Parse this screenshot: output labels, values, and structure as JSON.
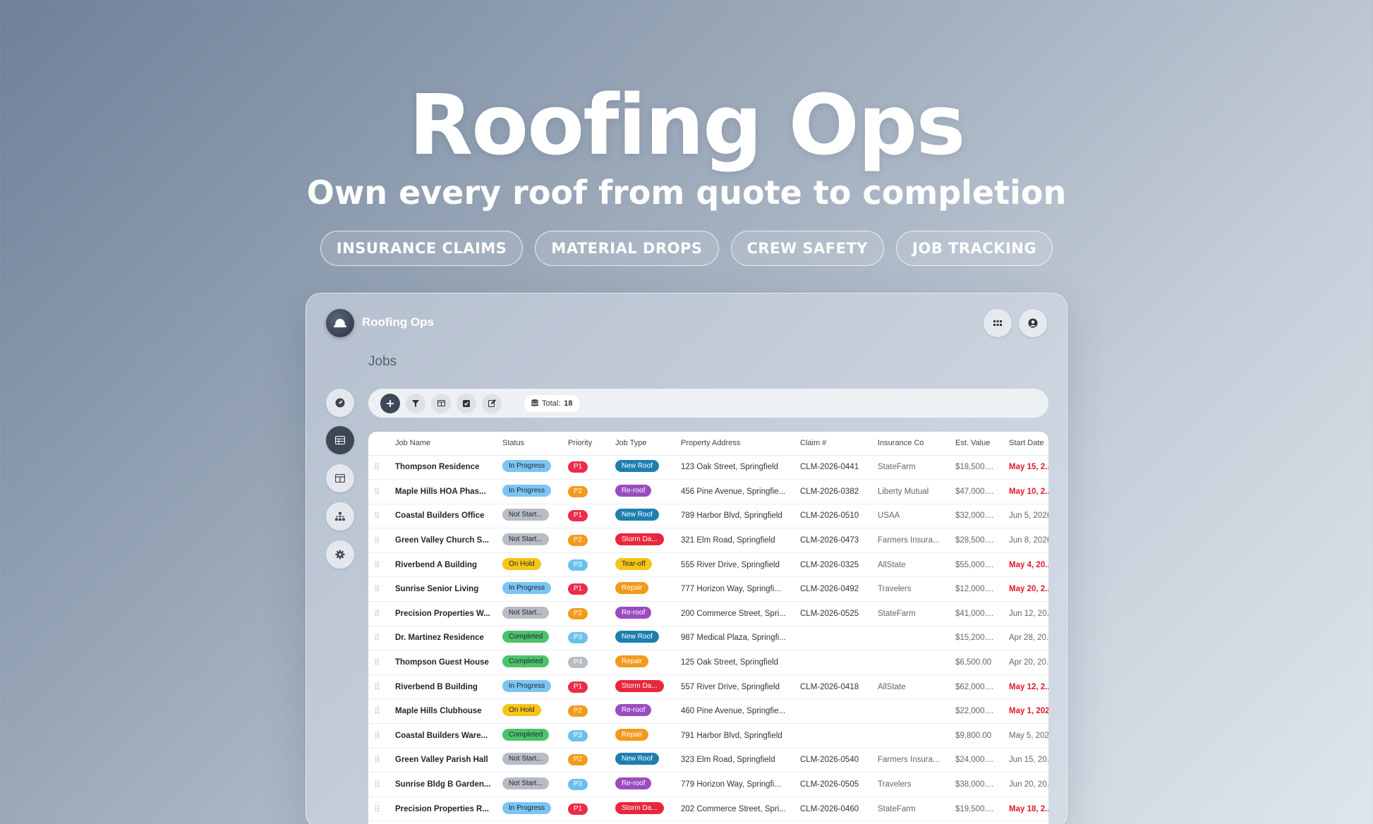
{
  "hero": {
    "title": "Roofing Ops",
    "subtitle": "Own every roof from quote to completion",
    "pills": [
      "INSURANCE CLAIMS",
      "MATERIAL DROPS",
      "CREW SAFETY",
      "JOB TRACKING"
    ]
  },
  "app": {
    "title": "Roofing Ops",
    "page_title": "Jobs",
    "total_label": "Total:",
    "total_value": "18",
    "sidebar": [
      "dashboard",
      "table-view",
      "board-view",
      "hierarchy",
      "settings"
    ]
  },
  "table": {
    "columns": [
      "Job Name",
      "Status",
      "Priority",
      "Job Type",
      "Property Address",
      "Claim #",
      "Insurance Co",
      "Est. Value",
      "Start Date"
    ],
    "rows": [
      {
        "job": "Thompson Residence",
        "status": "In Progress",
        "priority": "P1",
        "type": "New Roof",
        "address": "123 Oak Street, Springfield",
        "claim": "CLM-2026-0441",
        "insurer": "StateFarm",
        "value": "$18,500....",
        "date": "May 15, 2...",
        "overdue": true
      },
      {
        "job": "Maple Hills HOA Phas...",
        "status": "In Progress",
        "priority": "P2",
        "type": "Re-roof",
        "address": "456 Pine Avenue, Springfie...",
        "claim": "CLM-2026-0382",
        "insurer": "Liberty Mutual",
        "value": "$47,000....",
        "date": "May 10, 2...",
        "overdue": true
      },
      {
        "job": "Coastal Builders Office",
        "status": "Not Start...",
        "priority": "P1",
        "type": "New Roof",
        "address": "789 Harbor Blvd, Springfield",
        "claim": "CLM-2026-0510",
        "insurer": "USAA",
        "value": "$32,000....",
        "date": "Jun 5, 2026",
        "overdue": false
      },
      {
        "job": "Green Valley Church S...",
        "status": "Not Start...",
        "priority": "P2",
        "type": "Storm Da...",
        "address": "321 Elm Road, Springfield",
        "claim": "CLM-2026-0473",
        "insurer": "Farmers Insura...",
        "value": "$28,500....",
        "date": "Jun 8, 2026",
        "overdue": false
      },
      {
        "job": "Riverbend A Building",
        "status": "On Hold",
        "priority": "P3",
        "type": "Tear-off",
        "address": "555 River Drive, Springfield",
        "claim": "CLM-2026-0325",
        "insurer": "AllState",
        "value": "$55,000....",
        "date": "May 4, 20...",
        "overdue": true
      },
      {
        "job": "Sunrise Senior Living",
        "status": "In Progress",
        "priority": "P1",
        "type": "Repair",
        "address": "777 Horizon Way, Springfi...",
        "claim": "CLM-2026-0492",
        "insurer": "Travelers",
        "value": "$12,000....",
        "date": "May 20, 2...",
        "overdue": true
      },
      {
        "job": "Precision Properties W...",
        "status": "Not Start...",
        "priority": "P2",
        "type": "Re-roof",
        "address": "200 Commerce Street, Spri...",
        "claim": "CLM-2026-0525",
        "insurer": "StateFarm",
        "value": "$41,000....",
        "date": "Jun 12, 20...",
        "overdue": false
      },
      {
        "job": "Dr. Martinez Residence",
        "status": "Completed",
        "priority": "P3",
        "type": "New Roof",
        "address": "987 Medical Plaza, Springfi...",
        "claim": "",
        "insurer": "",
        "value": "$15,200....",
        "date": "Apr 28, 20...",
        "overdue": false
      },
      {
        "job": "Thompson Guest House",
        "status": "Completed",
        "priority": "P4",
        "type": "Repair",
        "address": "125 Oak Street, Springfield",
        "claim": "",
        "insurer": "",
        "value": "$6,500.00",
        "date": "Apr 20, 20...",
        "overdue": false
      },
      {
        "job": "Riverbend B Building",
        "status": "In Progress",
        "priority": "P1",
        "type": "Storm Da...",
        "address": "557 River Drive, Springfield",
        "claim": "CLM-2026-0418",
        "insurer": "AllState",
        "value": "$62,000....",
        "date": "May 12, 2...",
        "overdue": true
      },
      {
        "job": "Maple Hills Clubhouse",
        "status": "On Hold",
        "priority": "P2",
        "type": "Re-roof",
        "address": "460 Pine Avenue, Springfie...",
        "claim": "",
        "insurer": "",
        "value": "$22,000....",
        "date": "May 1, 202",
        "overdue": true
      },
      {
        "job": "Coastal Builders Ware...",
        "status": "Completed",
        "priority": "P3",
        "type": "Repair",
        "address": "791 Harbor Blvd, Springfield",
        "claim": "",
        "insurer": "",
        "value": "$9,800.00",
        "date": "May 5, 202",
        "overdue": false
      },
      {
        "job": "Green Valley Parish Hall",
        "status": "Not Start...",
        "priority": "P2",
        "type": "New Roof",
        "address": "323 Elm Road, Springfield",
        "claim": "CLM-2026-0540",
        "insurer": "Farmers Insura...",
        "value": "$24,000....",
        "date": "Jun 15, 20...",
        "overdue": false
      },
      {
        "job": "Sunrise Bldg B Garden...",
        "status": "Not Start...",
        "priority": "P3",
        "type": "Re-roof",
        "address": "779 Horizon Way, Springfi...",
        "claim": "CLM-2026-0505",
        "insurer": "Travelers",
        "value": "$38,000....",
        "date": "Jun 20, 20...",
        "overdue": false
      },
      {
        "job": "Precision Properties R...",
        "status": "In Progress",
        "priority": "P1",
        "type": "Storm Da...",
        "address": "202 Commerce Street, Spri...",
        "claim": "CLM-2026-0460",
        "insurer": "StateFarm",
        "value": "$19,500....",
        "date": "May 18, 2...",
        "overdue": true
      }
    ]
  },
  "colors": {
    "status": {
      "In Progress": "#7cc4f2",
      "Not Start...": "#b7bcc4",
      "On Hold": "#f5c518",
      "Completed": "#4cc26b"
    },
    "priority": {
      "P1": "#ec2c4a",
      "P2": "#f39a1c",
      "P3": "#6cc0ee",
      "P4": "#b7bcc4"
    },
    "type": {
      "New Roof": "#1d7fb0",
      "Re-roof": "#9a4dc0",
      "Storm Da...": "#e8273e",
      "Tear-off": "#f5c518",
      "Repair": "#f39a1c"
    }
  }
}
